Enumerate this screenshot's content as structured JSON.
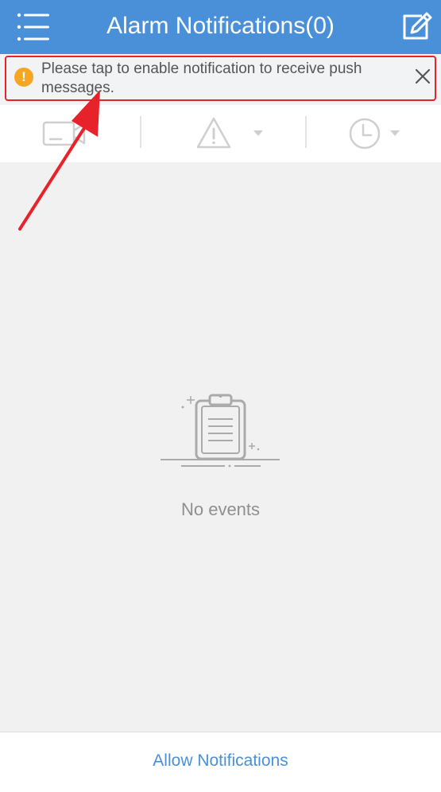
{
  "header": {
    "title": "Alarm Notifications(0)",
    "menu_icon": "hamburger-menu-icon",
    "edit_icon": "edit-pencil-icon"
  },
  "banner": {
    "icon": "warning-exclamation-icon",
    "message": "Please tap to enable notification to receive push messages.",
    "close_icon": "close-icon"
  },
  "filters": {
    "items": [
      {
        "icon": "camera-icon"
      },
      {
        "icon": "alert-triangle-icon",
        "has_dropdown": true
      },
      {
        "icon": "clock-icon",
        "has_dropdown": true
      }
    ]
  },
  "content": {
    "empty_icon": "clipboard-icon",
    "empty_text": "No events"
  },
  "footer": {
    "allow_label": "Allow Notifications"
  },
  "colors": {
    "header_bg": "#4a90d9",
    "accent": "#4a90d9",
    "warning": "#f5a623",
    "annotation_red": "#e8222a",
    "content_bg": "#f1f1f1"
  }
}
